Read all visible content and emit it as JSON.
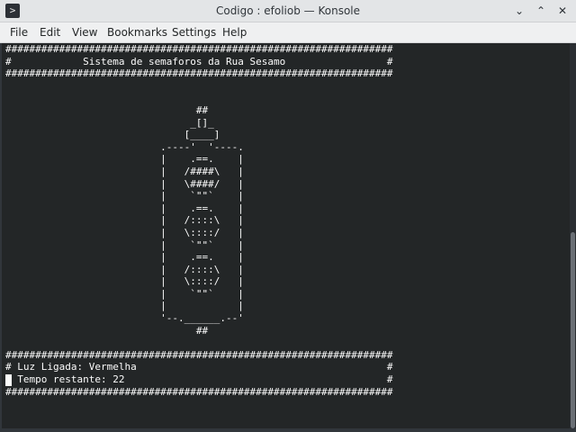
{
  "window": {
    "title": "Codigo : efoliob — Konsole",
    "app_icon": "terminal-icon",
    "buttons": {
      "minimize": "⌄",
      "maximize": "⌃",
      "close": "✕"
    }
  },
  "menu": [
    "File",
    "Edit",
    "View",
    "Bookmarks",
    "Settings",
    "Help"
  ],
  "terminal": {
    "lines": [
      "#################################################################",
      "#            Sistema de semaforos da Rua Sesamo                 #",
      "#################################################################",
      "",
      "",
      "                                ##",
      "                               _[]_",
      "                              [____]",
      "                          .----'  '----.",
      "                          |    .==.    |",
      "                          |   /####\\   |",
      "                          |   \\####/   |",
      "                          |    `\"\"`    |",
      "                          |    .==.    |",
      "                          |   /::::\\   |",
      "                          |   \\::::/   |",
      "                          |    `\"\"`    |",
      "                          |    .==.    |",
      "                          |   /::::\\   |",
      "                          |   \\::::/   |",
      "                          |    `\"\"`    |",
      "                          |            |",
      "                          '--.______.--'",
      "                                ##",
      "",
      "#################################################################",
      "# Luz Ligada: Vermelha                                          #",
      "# Tempo restante: 22                                            #",
      "#################################################################"
    ],
    "colors": {
      "background": "#232627",
      "foreground": "#fcfcfc"
    }
  },
  "scrollbar": {
    "thumb_fraction_start": 0.49,
    "thumb_fraction_end": 1.0
  }
}
